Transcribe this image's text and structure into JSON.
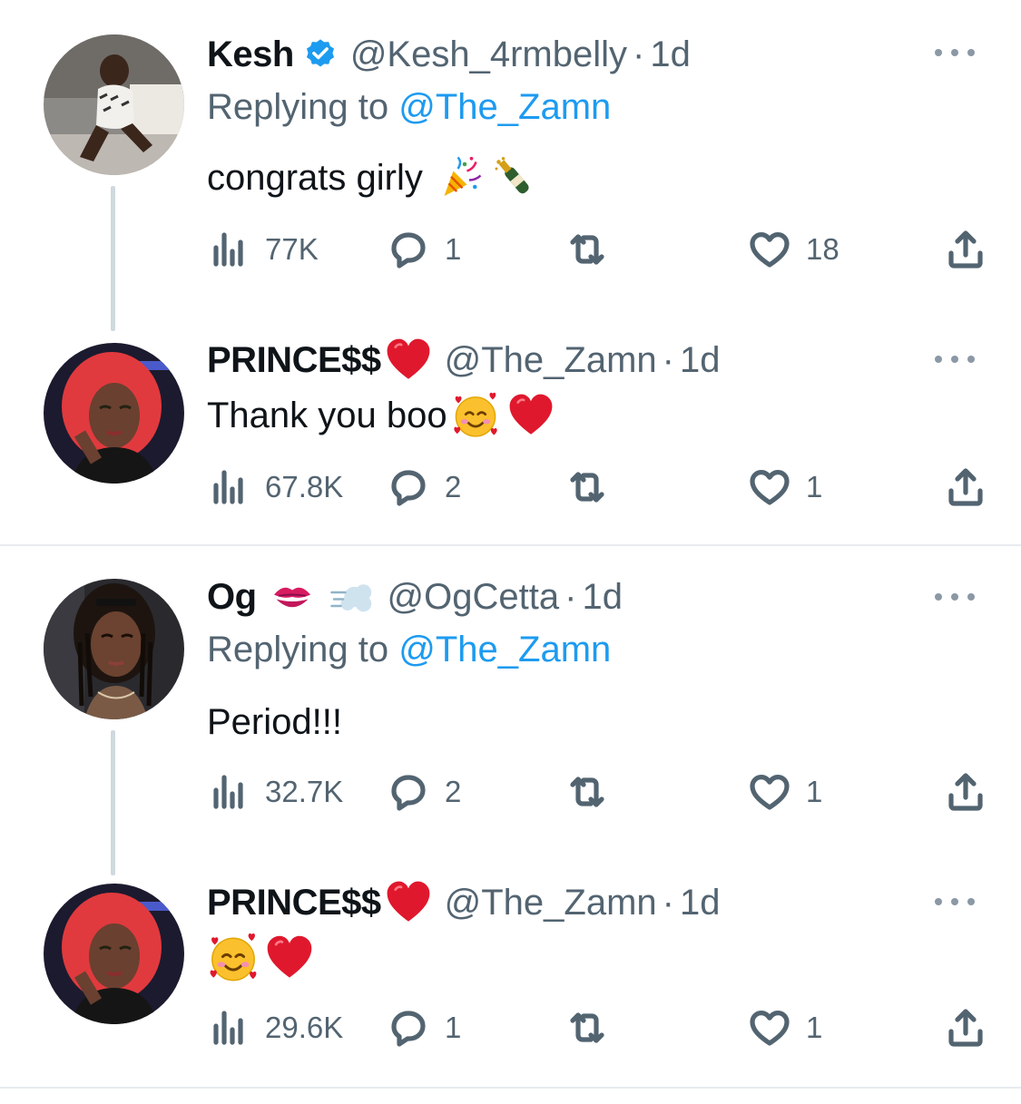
{
  "tweets": [
    {
      "name": "Kesh",
      "verified": true,
      "handle": "@Kesh_4rmbelly",
      "dot": "·",
      "time": "1d",
      "replying_prefix": "Replying to ",
      "replying_to": "@The_Zamn",
      "text": "congrats girly",
      "emojis": [
        "party-popper",
        "champagne-bottle"
      ],
      "stats": {
        "views": "77K",
        "replies": "1",
        "retweets": "",
        "likes": "18"
      }
    },
    {
      "name": "PRINCE$$",
      "name_emoji": "red-heart",
      "handle": "@The_Zamn",
      "dot": "·",
      "time": "1d",
      "text": "Thank you boo",
      "emojis": [
        "smiling-face-with-hearts",
        "red-heart"
      ],
      "stats": {
        "views": "67.8K",
        "replies": "2",
        "retweets": "",
        "likes": "1"
      }
    },
    {
      "name": "Og",
      "name_emojis": [
        "kiss-mark",
        "dashing-away"
      ],
      "handle": "@OgCetta",
      "dot": "·",
      "time": "1d",
      "replying_prefix": "Replying to ",
      "replying_to": "@The_Zamn",
      "text": "Period!!!",
      "stats": {
        "views": "32.7K",
        "replies": "2",
        "retweets": "",
        "likes": "1"
      }
    },
    {
      "name": "PRINCE$$",
      "name_emoji": "red-heart",
      "handle": "@The_Zamn",
      "dot": "·",
      "time": "1d",
      "text": "",
      "emojis": [
        "smiling-face-with-hearts",
        "red-heart"
      ],
      "stats": {
        "views": "29.6K",
        "replies": "1",
        "retweets": "",
        "likes": "1"
      }
    }
  ],
  "colors": {
    "link": "#1d9bf0",
    "secondary_text": "#536471",
    "primary_text": "#0f1419",
    "verified": "#1d9bf0",
    "heart": "#e0182d"
  }
}
